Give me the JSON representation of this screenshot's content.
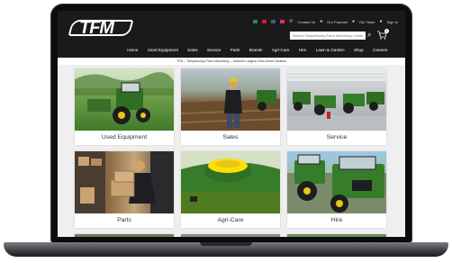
{
  "header": {
    "logo_text": "TFM",
    "util_links": [
      "Contact Us",
      "Our Purpose",
      "Our Team",
      "Sign In"
    ],
    "search_placeholder": "Search Templetuohy Farm Machinery Limited",
    "cart_count": "0"
  },
  "nav": {
    "items": [
      "Home",
      "Used Equipment",
      "Sales",
      "Service",
      "Parts",
      "Brands",
      "Agri-Care",
      "Hire",
      "Lawn & Garden",
      "Shop",
      "Careers"
    ]
  },
  "breadcrumb": "TFM – Templetuohy Farm Machinery – Ireland's Largest John Deere Dealers",
  "tiles": [
    {
      "label": "Used Equipment",
      "icon": "tractor-field-photo"
    },
    {
      "label": "Sales",
      "icon": "salesman-field-photo"
    },
    {
      "label": "Service",
      "icon": "workshop-photo"
    },
    {
      "label": "Parts",
      "icon": "parts-boxes-photo"
    },
    {
      "label": "Agri-Care",
      "icon": "gps-receiver-photo"
    },
    {
      "label": "Hire",
      "icon": "tractor-yard-photo"
    }
  ],
  "colors": {
    "header_bg": "#1a1a1a",
    "john_deere_green": "#367c2b",
    "john_deere_yellow": "#ffde00"
  }
}
